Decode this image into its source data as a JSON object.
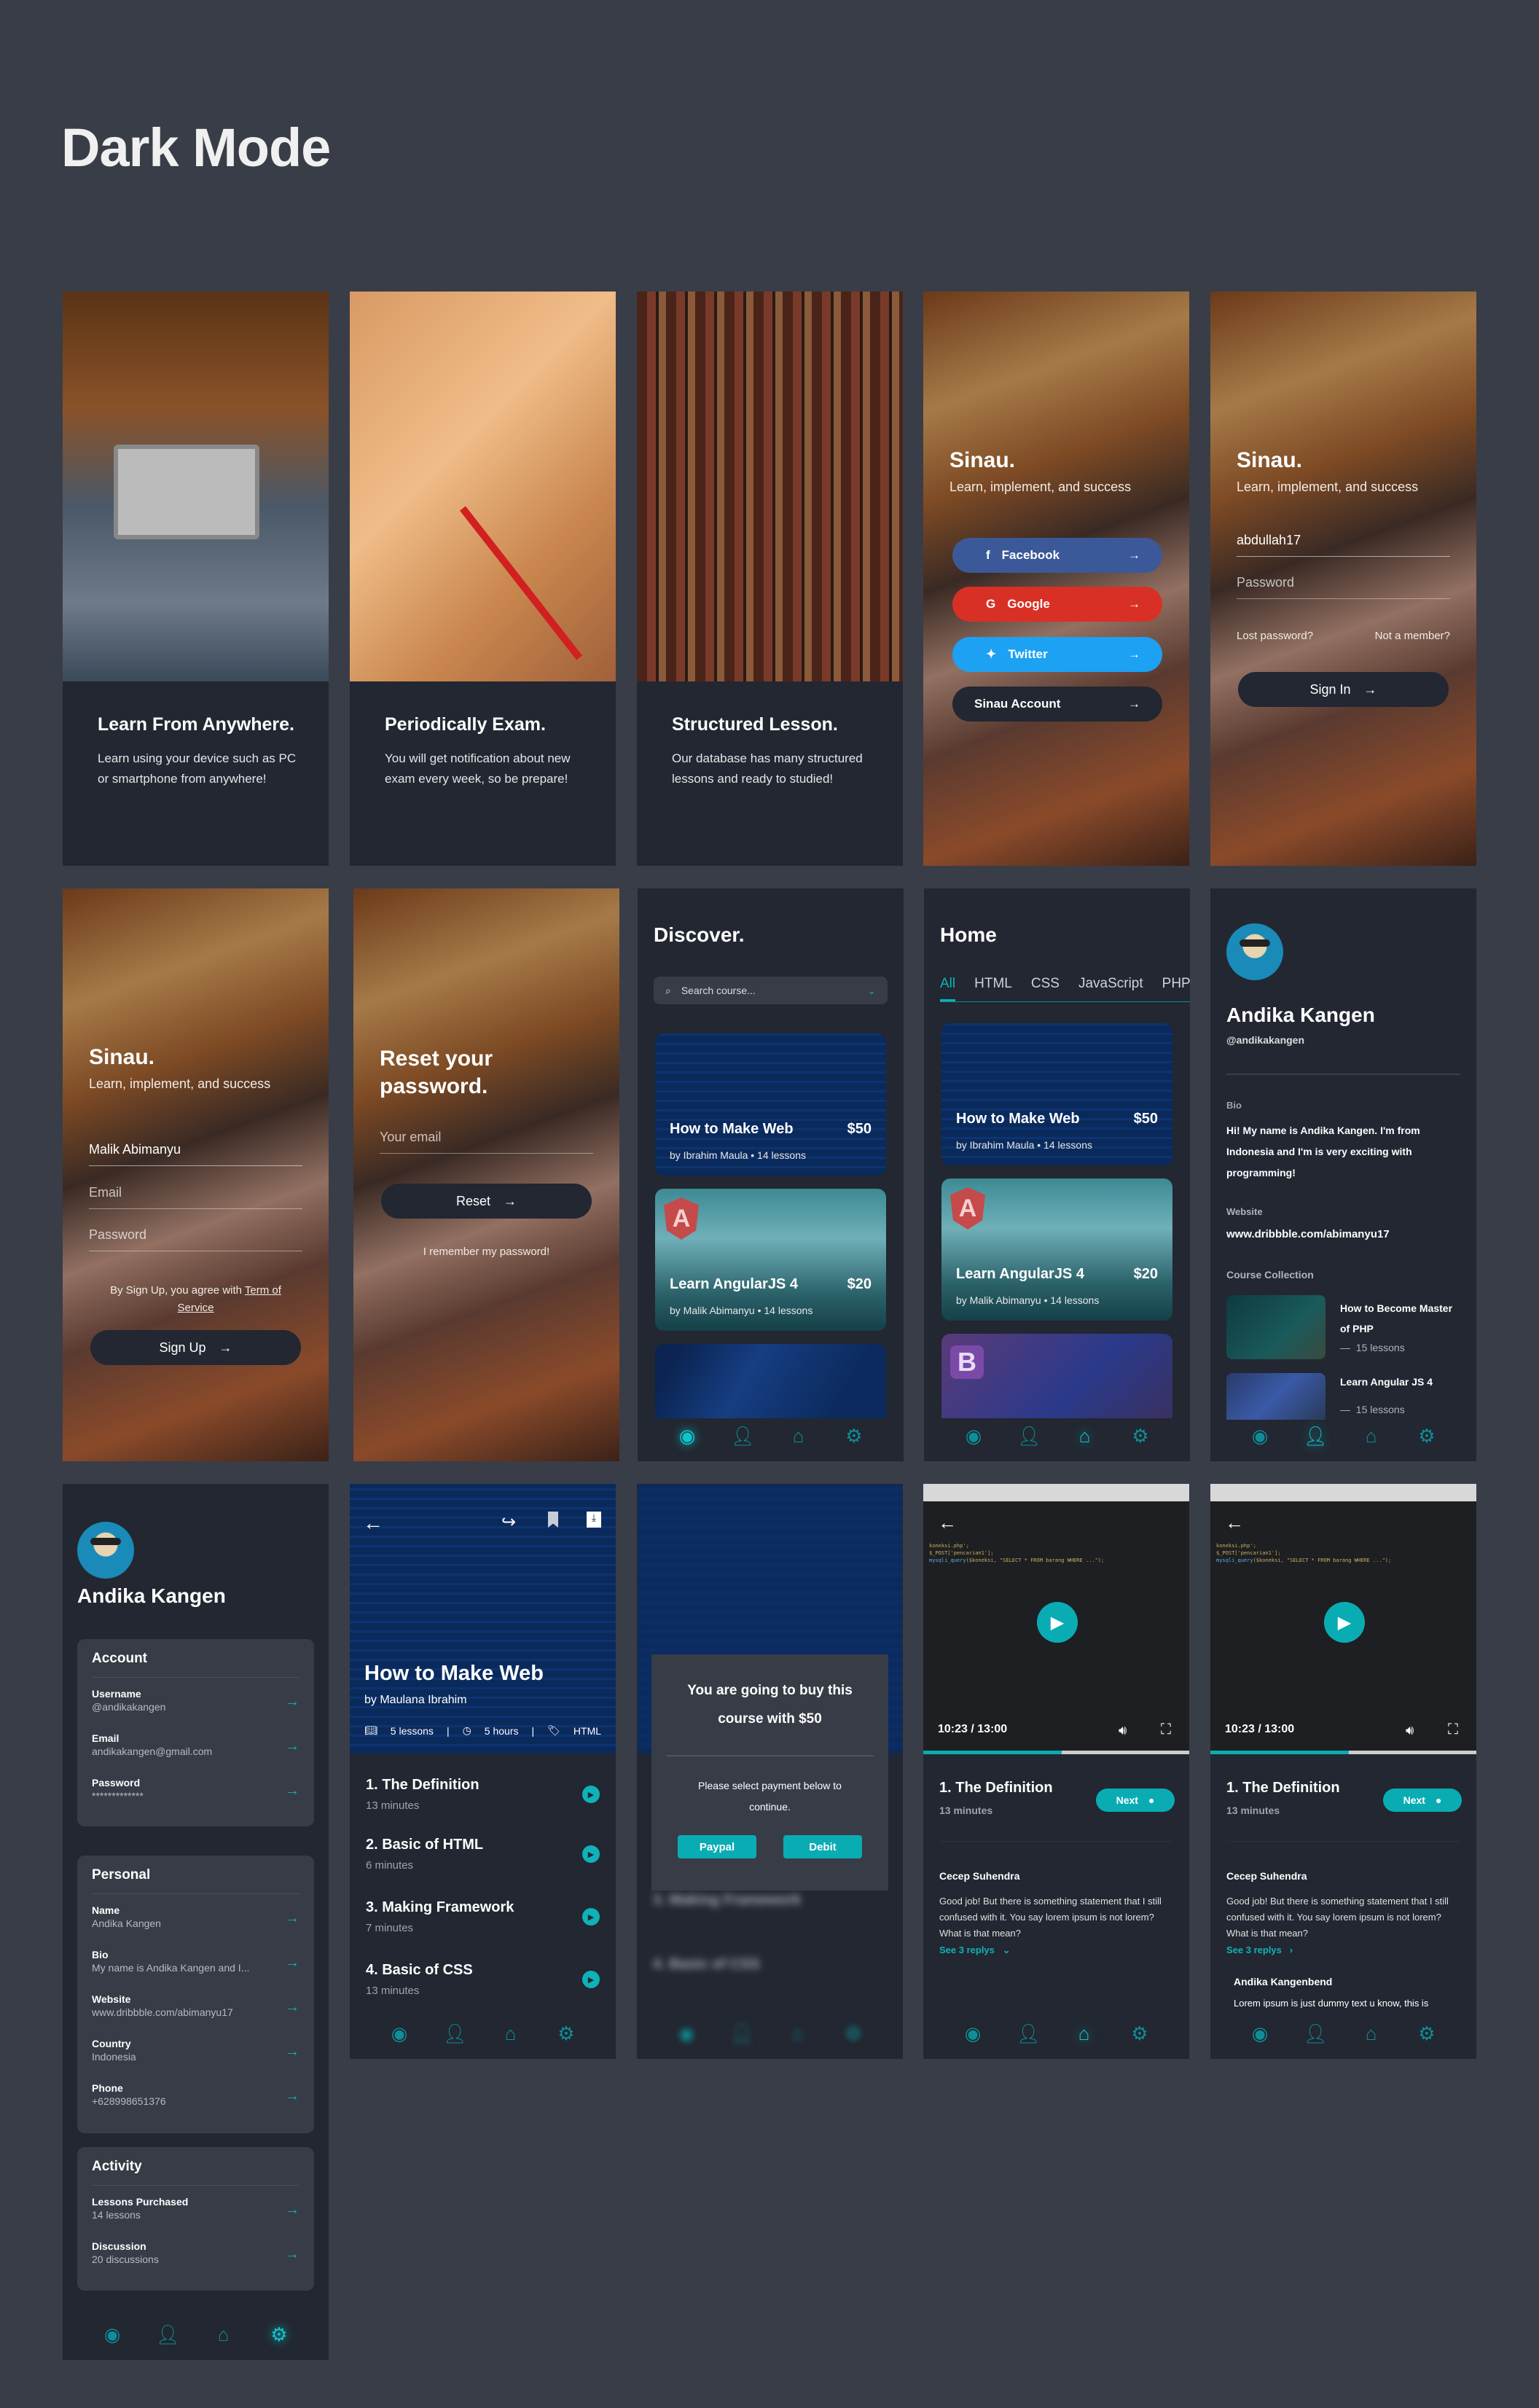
{
  "page_title": "Dark Mode",
  "colors": {
    "accent": "#0fb2b8",
    "screen_bg": "#222731",
    "page_bg": "#393d47",
    "facebook": "#3b5998",
    "google": "#d93025",
    "twitter": "#1da1f2"
  },
  "onboarding": [
    {
      "title": "Learn From Anywhere.",
      "body": "Learn using your device such as PC or smartphone from anywhere!",
      "indicator": "dots",
      "active_dot": 2
    },
    {
      "title": "Periodically Exam.",
      "body": "You will get notification about new exam every week, so be prepare!",
      "indicator": "arrow-right-icon"
    },
    {
      "title": "Structured Lesson.",
      "body": "Our database has many structured lessons and ready to studied!",
      "indicator": "dots",
      "active_dot": 1
    }
  ],
  "brand": {
    "name": "Sinau.",
    "tagline": "Learn, implement, and success"
  },
  "social_login": {
    "buttons": [
      {
        "label": "Facebook",
        "icon": "facebook-icon"
      },
      {
        "label": "Google",
        "icon": "google-icon"
      },
      {
        "label": "Twitter",
        "icon": "twitter-icon"
      },
      {
        "label": "Sinau Account",
        "icon": ""
      }
    ],
    "arrow": "→"
  },
  "sign_in": {
    "username_value": "abdullah17",
    "password_placeholder": "Password",
    "lost_password": "Lost password?",
    "not_member": "Not a member?",
    "button": "Sign In"
  },
  "sign_up": {
    "name_value": "Malik Abimanyu",
    "email_placeholder": "Email",
    "password_placeholder": "Password",
    "agree_text": "By Sign Up, you agree with",
    "terms_link": "Term of Service",
    "button": "Sign Up"
  },
  "reset": {
    "title": "Reset your password.",
    "email_placeholder": "Your email",
    "button": "Reset",
    "remember": "I remember my password!"
  },
  "discover": {
    "title": "Discover.",
    "search_placeholder": "Search course...",
    "courses": [
      {
        "title": "How to Make Web",
        "price": "$50",
        "meta": "by Ibrahim Maula  •  14 lessons"
      },
      {
        "title": "Learn AngularJS 4",
        "price": "$20",
        "meta": "by Malik Abimanyu  •  14 lessons"
      }
    ]
  },
  "home": {
    "title": "Home",
    "tabs": [
      "All",
      "HTML",
      "CSS",
      "JavaScript",
      "PHP"
    ],
    "active_tab": "All",
    "courses": [
      {
        "title": "How to Make Web",
        "price": "$50",
        "meta": "by Ibrahim Maula  •  14 lessons"
      },
      {
        "title": "Learn AngularJS 4",
        "price": "$20",
        "meta": "by Malik Abimanyu  •  14 lessons"
      }
    ]
  },
  "profile": {
    "name": "Andika Kangen",
    "handle": "@andikakangen",
    "bio_label": "Bio",
    "bio": "Hi! My name is Andika Kangen. I'm from Indonesia and I'm is very exciting with programming!",
    "website_label": "Website",
    "website": "www.dribbble.com/abimanyu17",
    "collection_label": "Course Collection",
    "collection": [
      {
        "title": "How to Become Master of PHP",
        "lessons": "15 lessons"
      },
      {
        "title": "Learn Angular JS 4",
        "lessons": "15 lessons"
      }
    ]
  },
  "settings": {
    "name": "Andika Kangen",
    "groups": [
      {
        "title": "Account",
        "rows": [
          {
            "label": "Username",
            "value": "@andikakangen"
          },
          {
            "label": "Email",
            "value": "andikakangen@gmail.com"
          },
          {
            "label": "Password",
            "value": "*************"
          }
        ]
      },
      {
        "title": "Personal",
        "rows": [
          {
            "label": "Name",
            "value": "Andika Kangen"
          },
          {
            "label": "Bio",
            "value": "My name is Andika Kangen and I..."
          },
          {
            "label": "Website",
            "value": "www.dribbble.com/abimanyu17"
          },
          {
            "label": "Country",
            "value": "Indonesia"
          },
          {
            "label": "Phone",
            "value": "+628998651376"
          }
        ]
      },
      {
        "title": "Activity",
        "rows": [
          {
            "label": "Lessons Purchased",
            "value": "14 lessons"
          },
          {
            "label": "Discussion",
            "value": "20 discussions"
          }
        ]
      }
    ]
  },
  "course_detail": {
    "title": "How to Make Web",
    "author": "by Maulana Ibrahim",
    "lessons_count": "5 lessons",
    "duration": "5 hours",
    "tag": "HTML",
    "lessons": [
      {
        "title": "1. The Definition",
        "duration": "13 minutes"
      },
      {
        "title": "2. Basic of HTML",
        "duration": "6 minutes"
      },
      {
        "title": "3. Making Framework",
        "duration": "7 minutes"
      },
      {
        "title": "4. Basic of CSS",
        "duration": "13 minutes"
      }
    ]
  },
  "purchase_dialog": {
    "title": "You are going to buy this course with $50",
    "body": "Please select payment below to continue.",
    "paypal": "Paypal",
    "debit": "Debit"
  },
  "video": {
    "time": "10:23 / 13:00",
    "progress": 0.52,
    "lesson_title": "1. The Definition",
    "lesson_duration": "13 minutes",
    "next": "Next",
    "comment_author": "Cecep Suhendra",
    "comment": "Good job! But there is something statement that I still confused with it. You say lorem ipsum is not lorem? What is that mean?",
    "replies_link": "See 3 replys",
    "reply_author": "Andika Kangenbend",
    "reply": "Lorem ipsum is just dummy text u know, this is"
  },
  "nav_icons": [
    "compass-icon",
    "user-icon",
    "home-icon",
    "gear-icon"
  ]
}
